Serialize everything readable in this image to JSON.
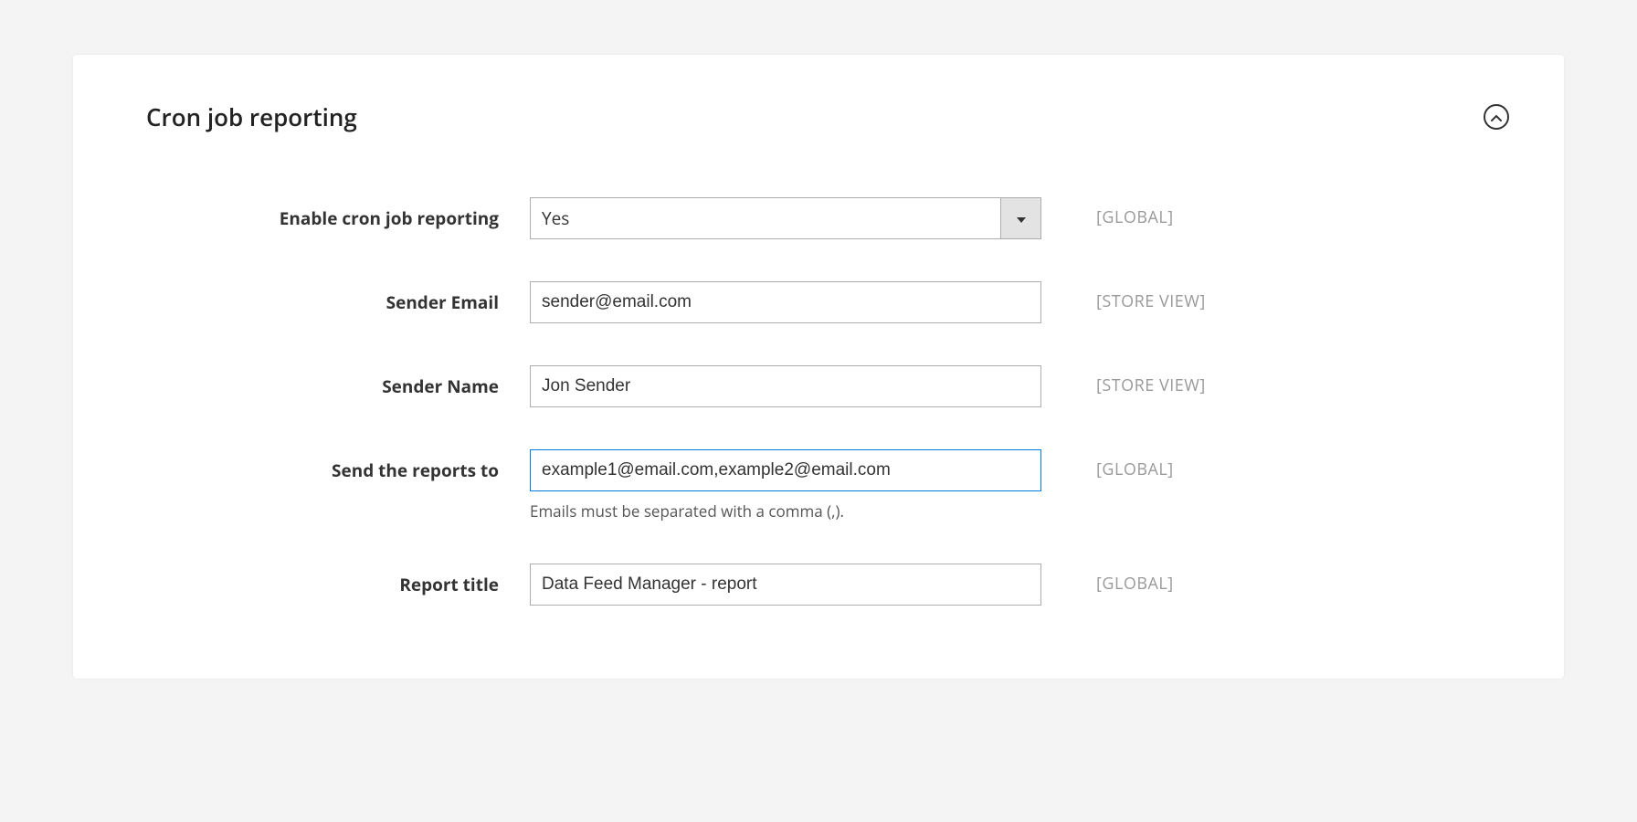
{
  "section": {
    "title": "Cron job reporting"
  },
  "fields": {
    "enable_reporting": {
      "label": "Enable cron job reporting",
      "value": "Yes",
      "scope": "[GLOBAL]"
    },
    "sender_email": {
      "label": "Sender Email",
      "value": "sender@email.com",
      "scope": "[STORE VIEW]"
    },
    "sender_name": {
      "label": "Sender Name",
      "value": "Jon Sender",
      "scope": "[STORE VIEW]"
    },
    "reports_to": {
      "label": "Send the reports to",
      "value": "example1@email.com,example2@email.com",
      "help": "Emails must be separated with a comma (,).",
      "scope": "[GLOBAL]"
    },
    "report_title": {
      "label": "Report title",
      "value": "Data Feed Manager - report",
      "scope": "[GLOBAL]"
    }
  }
}
